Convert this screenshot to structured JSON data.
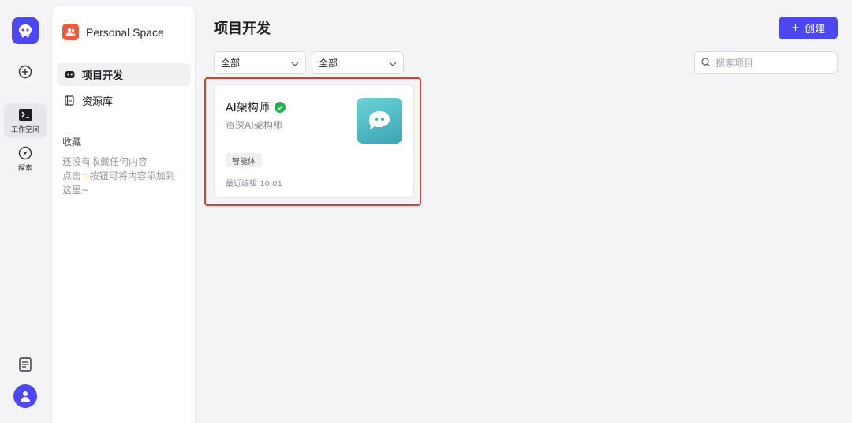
{
  "rail": {
    "nav": [
      {
        "label": "工作空间",
        "active": true
      },
      {
        "label": "探索",
        "active": false
      }
    ]
  },
  "sidebar": {
    "space_name": "Personal Space",
    "items": [
      {
        "label": "项目开发",
        "active": true
      },
      {
        "label": "资源库",
        "active": false
      }
    ],
    "favorites_title": "收藏",
    "favorites_empty_line1": "还没有收藏任何内容",
    "favorites_empty_line2a": "点击",
    "favorites_empty_line2b": "按钮可将内容添加到",
    "favorites_empty_line3": "这里~"
  },
  "main": {
    "title": "项目开发",
    "create_label": "创建",
    "filters": [
      {
        "value": "全部"
      },
      {
        "value": "全部"
      }
    ],
    "search_placeholder": "搜索项目"
  },
  "cards": [
    {
      "title": "AI架构师",
      "verified": true,
      "description": "资深AI架构师",
      "tag": "智能体",
      "meta": "最近编辑 10:01"
    }
  ],
  "colors": {
    "accent": "#4e47f0",
    "space_icon": "#ea5c42",
    "verified": "#22b14c",
    "highlight": "#e33a2f"
  }
}
